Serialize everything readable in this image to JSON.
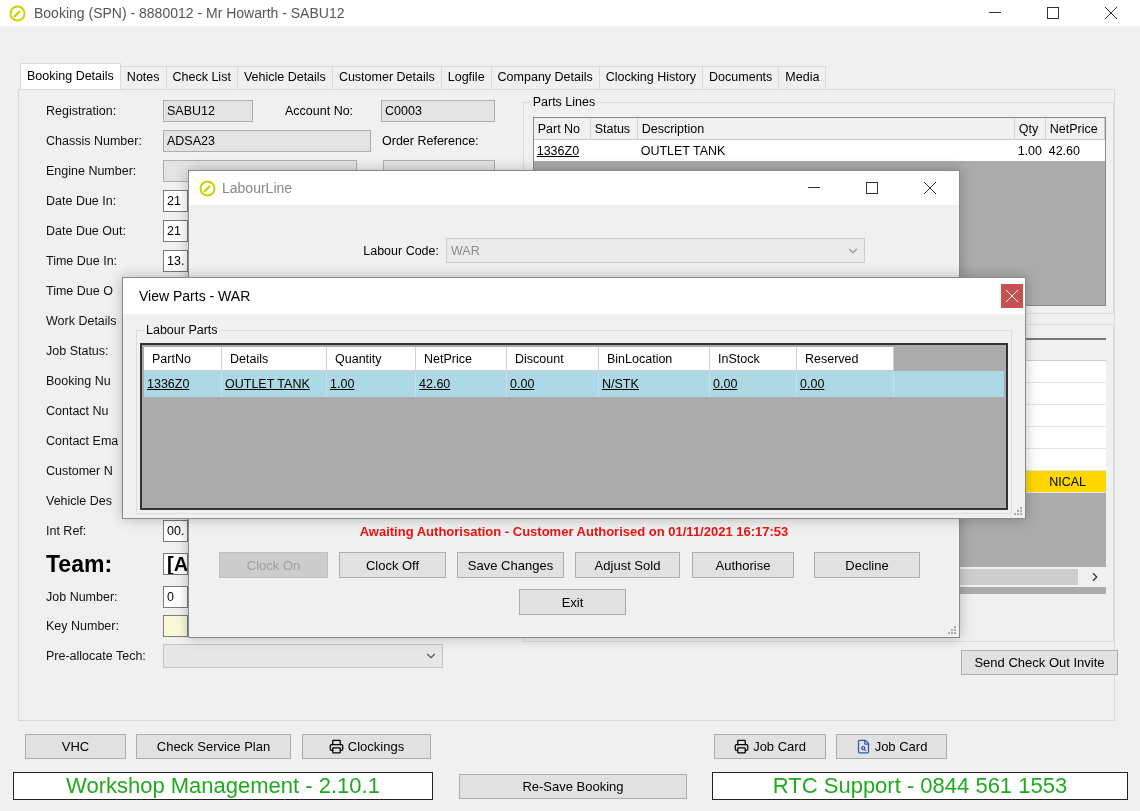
{
  "window": {
    "title": "Booking (SPN) - 8880012 - Mr Howarth - SABU12"
  },
  "tabs": [
    {
      "label": "Booking Details",
      "selected": true
    },
    {
      "label": "Notes",
      "selected": false
    },
    {
      "label": "Check List",
      "selected": false
    },
    {
      "label": "Vehicle Details",
      "selected": false
    },
    {
      "label": "Customer Details",
      "selected": false
    },
    {
      "label": "Logfile",
      "selected": false
    },
    {
      "label": "Company Details",
      "selected": false
    },
    {
      "label": "Clocking History",
      "selected": false
    },
    {
      "label": "Documents",
      "selected": false
    },
    {
      "label": "Media",
      "selected": false
    }
  ],
  "form_rows": [
    {
      "label": "Registration:",
      "kind": "short",
      "value": "SABU12"
    },
    {
      "label": "Chassis Number:",
      "kind": "long",
      "value": "ADSA23"
    },
    {
      "label": "Engine Number:",
      "kind": "medium"
    },
    {
      "label": "Date Due In:",
      "kind": "stub",
      "value": "21"
    },
    {
      "label": "Date Due Out:",
      "kind": "stub",
      "value": "21"
    },
    {
      "label": "Time Due In:",
      "kind": "stub",
      "value": "13."
    },
    {
      "label": "Time Due O",
      "kind": "none"
    },
    {
      "label": "Work Details",
      "kind": "none"
    },
    {
      "label": "Job Status:",
      "kind": "none"
    },
    {
      "label": "Booking Nu",
      "kind": "none"
    },
    {
      "label": "Contact Nu",
      "kind": "none"
    },
    {
      "label": "Contact Ema",
      "kind": "none"
    },
    {
      "label": "Customer N",
      "kind": "none"
    },
    {
      "label": "Vehicle Des",
      "kind": "none"
    },
    {
      "label": "Int Ref:",
      "kind": "stub",
      "value": "00."
    },
    {
      "label": "Team:",
      "kind": "team",
      "value": "[A"
    },
    {
      "label": "Job Number:",
      "kind": "stub",
      "value": "0"
    },
    {
      "label": "Key Number:",
      "kind": "key"
    },
    {
      "label": "Pre-allocate Tech:",
      "kind": "combo"
    }
  ],
  "account": {
    "label": "Account No:",
    "value": "C0003",
    "readonly": true
  },
  "order_reference": {
    "label": "Order Reference:",
    "readonly": true
  },
  "parts_lines": {
    "title": "Parts Lines",
    "columns": [
      "Part No",
      "Status",
      "Description",
      "Qty",
      "NetPrice"
    ],
    "rows": [
      {
        "part_no": "1336Z0",
        "description": "OUTLET TANK",
        "qty": "1.00",
        "net_price": "42.60"
      }
    ]
  },
  "job_lines": {
    "rows": [
      {
        "highlighted": false
      },
      {
        "highlighted": false
      },
      {
        "highlighted": false
      },
      {
        "highlighted": false
      },
      {
        "highlighted": false
      },
      {
        "text": "NICAL",
        "highlighted": true
      }
    ]
  },
  "send_invite_button": "Send Check Out Invite",
  "toolbar": [
    {
      "label": "VHC",
      "kind": "plain"
    },
    {
      "label": "Check Service Plan",
      "kind": "plain"
    },
    {
      "label": "Clockings",
      "kind": "print"
    },
    {
      "label": "Job Card",
      "kind": "print"
    },
    {
      "label": "Job Card",
      "kind": "preview"
    }
  ],
  "footer": {
    "version": "Workshop Management - 2.10.1",
    "resave_button": "Re-Save Booking",
    "support": "RTC Support - 0844 561 1553"
  },
  "labour_dialog": {
    "title": "LabourLine",
    "labour_code": {
      "label": "Labour Code:",
      "value": "WAR",
      "disabled": true
    },
    "message": "Awaiting Authorisation - Customer Authorised on 01/11/2021 16:17:53",
    "buttons": [
      {
        "label": "Clock On",
        "disabled": true
      },
      {
        "label": "Clock Off",
        "disabled": false
      },
      {
        "label": "Save Changes",
        "disabled": false
      },
      {
        "label": "Adjust Sold",
        "disabled": false
      },
      {
        "label": "Authorise",
        "disabled": false
      },
      {
        "label": "Decline",
        "disabled": false
      }
    ],
    "exit_button": "Exit"
  },
  "view_parts_dialog": {
    "title": "View Parts - WAR",
    "group": "Labour Parts",
    "columns": [
      "PartNo",
      "Details",
      "Quantity",
      "NetPrice",
      "Discount",
      "BinLocation",
      "InStock",
      "Reserved"
    ],
    "rows": [
      {
        "selected": true,
        "cells": [
          "1336Z0",
          "OUTLET TANK",
          "1.00",
          "42.60",
          "0.00",
          "N/STK",
          "0.00",
          "0.00"
        ]
      }
    ]
  }
}
